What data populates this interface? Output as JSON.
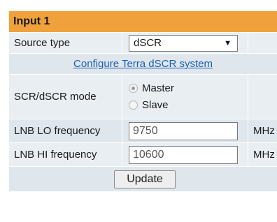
{
  "panel": {
    "title": "Input 1"
  },
  "source_type": {
    "label": "Source type",
    "selected": "dSCR",
    "arrow": "▼"
  },
  "configure_link": "Configure Terra dSCR system",
  "scr_mode": {
    "label": "SCR/dSCR mode",
    "options": [
      "Master",
      "Slave"
    ],
    "selected": "Master"
  },
  "lnb_lo": {
    "label": "LNB LO frequency",
    "value": "9750",
    "unit": "MHz"
  },
  "lnb_hi": {
    "label": "LNB HI frequency",
    "value": "10600",
    "unit": "MHz"
  },
  "update_button": "Update",
  "colors": {
    "header": "#f0a13c",
    "row": "#e9eef2",
    "link": "#1a5fb4"
  }
}
